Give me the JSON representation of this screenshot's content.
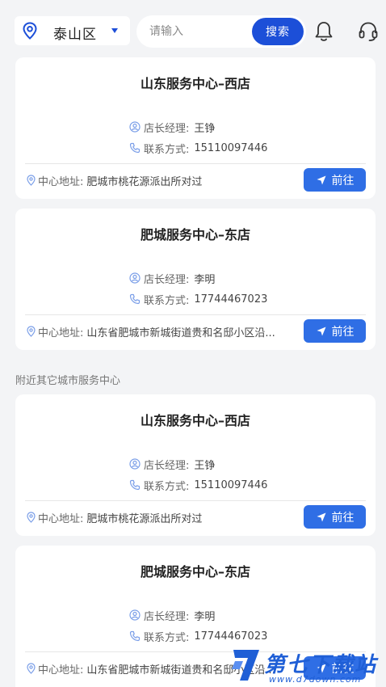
{
  "header": {
    "location": "泰山区",
    "search_placeholder": "请输入",
    "search_button": "搜索"
  },
  "labels": {
    "manager": "店长经理:",
    "contact": "联系方式:",
    "address": "中心地址:",
    "go": "前往"
  },
  "nearby_section_title": "附近其它城市服务中心",
  "cards": [
    {
      "title": "山东服务中心–西店",
      "manager": "王铮",
      "phone": "15110097446",
      "address": "肥城市桃花源派出所对过"
    },
    {
      "title": "肥城服务中心–东店",
      "manager": "李明",
      "phone": "17744467023",
      "address": "山东省肥城市新城街道贵和名邸小区沿..."
    },
    {
      "title": "山东服务中心–西店",
      "manager": "王铮",
      "phone": "15110097446",
      "address": "肥城市桃花源派出所对过"
    },
    {
      "title": "肥城服务中心–东店",
      "manager": "李明",
      "phone": "17744467023",
      "address": "山东省肥城市新城街道贵和名邸小区沿..."
    }
  ],
  "watermark": {
    "title": "第七下载站",
    "url": "www.d7down.com"
  },
  "colors": {
    "accent": "#1c4fd8",
    "button": "#2f6ee5",
    "background": "#f3f4f6"
  }
}
